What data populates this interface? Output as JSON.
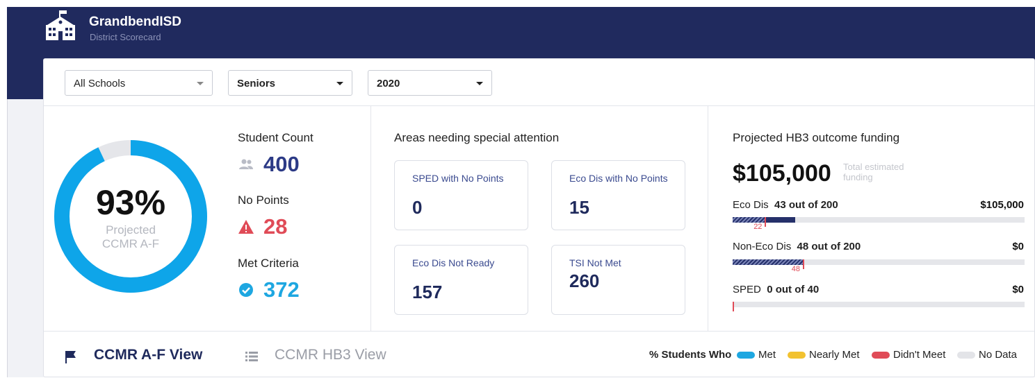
{
  "header": {
    "title": "GrandbendISD",
    "subtitle": "District Scorecard",
    "logo_icon": "school-icon",
    "background": "#202a5e"
  },
  "filters": {
    "school": "All Schools",
    "group": "Seniors",
    "year": "2020"
  },
  "summary": {
    "percent": "93%",
    "percent_label_line1": "Projected",
    "percent_label_line2": "CCMR A-F",
    "donut_fill_fraction": 0.93,
    "donut_color": "#0ea5e9",
    "donut_empty_color": "#e5e6ea"
  },
  "stats": {
    "student_count_label": "Student Count",
    "student_count": "400",
    "no_points_label": "No Points",
    "no_points": "28",
    "met_criteria_label": "Met Criteria",
    "met_criteria": "372",
    "colors": {
      "count": "#2c3a86",
      "warning": "#e04b57",
      "met": "#1ea7e1"
    }
  },
  "attention": {
    "title": "Areas needing special attention",
    "tiles": [
      {
        "label": "SPED with No Points",
        "value": "0"
      },
      {
        "label": "Eco Dis with No Points",
        "value": "15"
      },
      {
        "label": "Eco Dis Not Ready",
        "value": "157"
      },
      {
        "label": "TSI Not Met",
        "value": "260"
      }
    ]
  },
  "funding": {
    "title": "Projected HB3 outcome funding",
    "total": "$105,000",
    "total_note": "Total estimated funding",
    "rows": [
      {
        "name": "Eco Dis",
        "detail": "43 out of 200",
        "amount": "$105,000",
        "marker": "22",
        "count": 43,
        "of": 200,
        "marker_value": 22
      },
      {
        "name": "Non-Eco Dis",
        "detail": "48 out of 200",
        "amount": "$0",
        "marker": "48",
        "count": 48,
        "of": 200,
        "marker_value": 48
      },
      {
        "name": "SPED",
        "detail": "0 out of 40",
        "amount": "$0",
        "marker": "",
        "count": 0,
        "of": 40,
        "marker_value": 0
      }
    ]
  },
  "views": {
    "tab_af": "CCMR A-F View",
    "tab_hb3": "CCMR HB3 View",
    "legend_title": "% Students Who",
    "legend": [
      {
        "label": "Met",
        "color": "#1ea7e1"
      },
      {
        "label": "Nearly Met",
        "color": "#f2c230"
      },
      {
        "label": "Didn't Meet",
        "color": "#e04b57"
      },
      {
        "label": "No Data",
        "color": "#e3e4e8"
      }
    ]
  }
}
